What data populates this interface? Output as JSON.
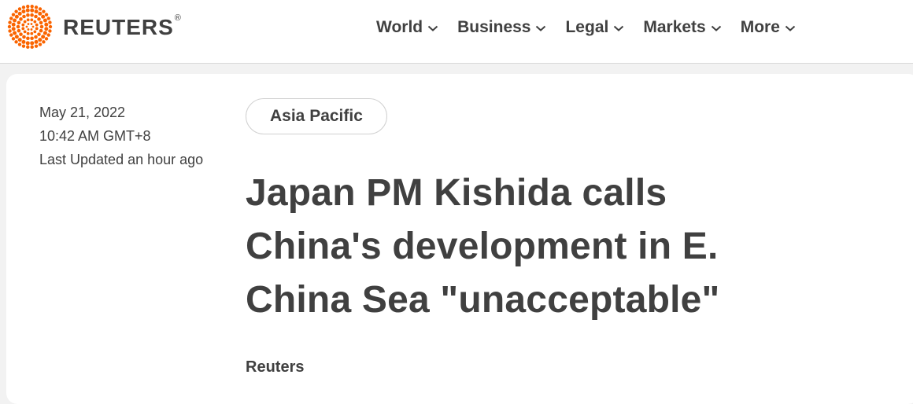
{
  "brand": {
    "name": "REUTERS",
    "registered_mark": "®",
    "accent_color": "#fa6400"
  },
  "nav": {
    "items": [
      {
        "label": "World",
        "icon": "chevron-down-icon"
      },
      {
        "label": "Business",
        "icon": "chevron-down-icon"
      },
      {
        "label": "Legal",
        "icon": "chevron-down-icon"
      },
      {
        "label": "Markets",
        "icon": "chevron-down-icon"
      },
      {
        "label": "More",
        "icon": "chevron-down-icon"
      }
    ]
  },
  "article": {
    "date": "May 21, 2022",
    "time": "10:42 AM GMT+8",
    "updated": "Last Updated an hour ago",
    "section_tag": "Asia Pacific",
    "headline": "Japan PM Kishida calls China's development in E. China Sea \"unacceptable\"",
    "byline": "Reuters"
  }
}
